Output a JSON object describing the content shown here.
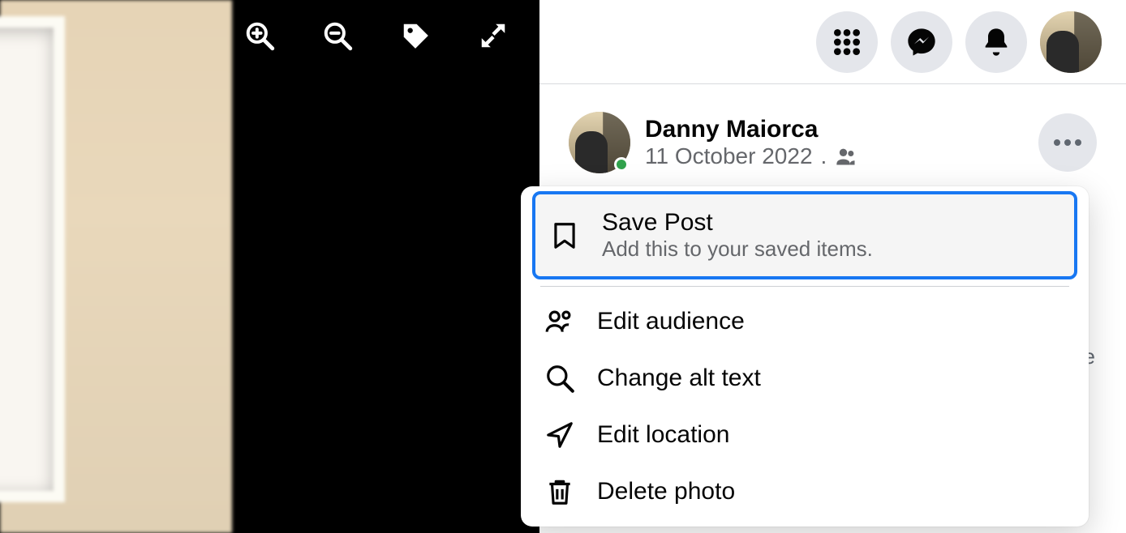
{
  "viewer": {
    "tools": [
      "zoom-in",
      "zoom-out",
      "tag",
      "fullscreen"
    ]
  },
  "topbar": {
    "apps_icon": "menu-grid",
    "messenger_icon": "messenger",
    "notifications_icon": "bell"
  },
  "post": {
    "author": "Danny Maiorca",
    "date": "11 October 2022",
    "separator": ".",
    "audience_icon": "friends"
  },
  "menu": {
    "save": {
      "title": "Save Post",
      "subtitle": "Add this to your saved items."
    },
    "edit_audience": "Edit audience",
    "change_alt": "Change alt text",
    "edit_location": "Edit location",
    "delete_photo": "Delete photo"
  },
  "peek": {
    "char": "e"
  }
}
